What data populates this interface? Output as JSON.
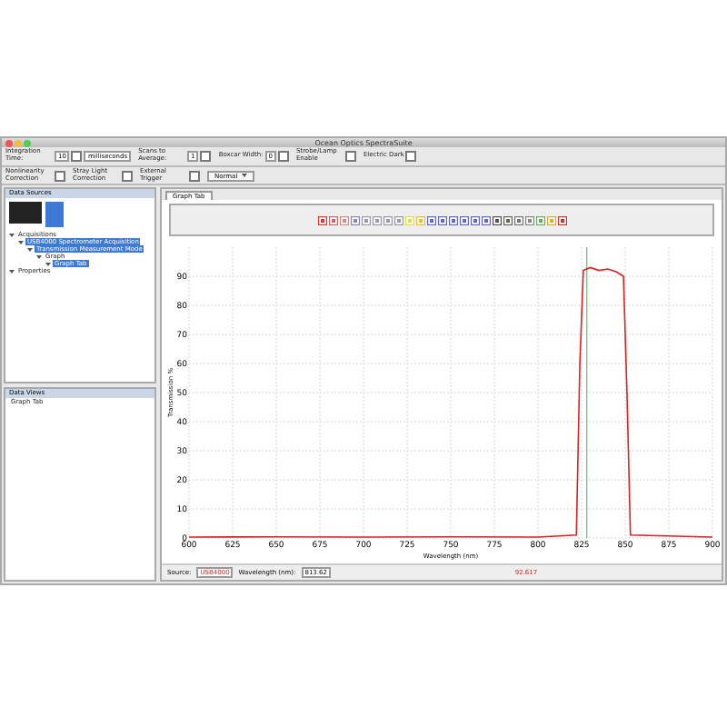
{
  "window": {
    "title": "Ocean Optics SpectraSuite"
  },
  "toolbar": {
    "controls": [
      {
        "kind": "spinner",
        "label": "Integration Time:",
        "value": "10",
        "unit": "milliseconds"
      },
      {
        "kind": "spinner",
        "label": "Scans to Average:",
        "value": "1"
      },
      {
        "kind": "spinner",
        "label": "Boxcar Width:",
        "value": "0"
      },
      {
        "kind": "check",
        "label": "Strobe/Lamp Enable",
        "checked": false
      },
      {
        "kind": "check",
        "label": "Electric Dark",
        "checked": false
      }
    ]
  },
  "toolbar_2": {
    "controls": [
      {
        "kind": "check",
        "label": "Nonlinearity Correction",
        "checked": false
      },
      {
        "kind": "check",
        "label": "Stray Light Correction",
        "checked": false
      },
      {
        "kind": "check",
        "label": "External Trigger",
        "checked": false
      },
      {
        "kind": "select",
        "value": "Normal"
      }
    ]
  },
  "data_sources": {
    "title": "Data Sources",
    "tree": [
      {
        "label": "Acquisitions",
        "selected": false,
        "children": [
          {
            "label": "USB4000 Spectrometer Acquisition",
            "selected": true,
            "children": [
              {
                "label": "Transmission Measurement Mode",
                "selected": true,
                "children": [
                  {
                    "label": "Graph",
                    "selected": false,
                    "children": [
                      {
                        "label": "Graph Tab",
                        "selected": true
                      }
                    ]
                  }
                ]
              }
            ]
          }
        ]
      },
      {
        "label": "Properties",
        "selected": false
      }
    ]
  },
  "data_views": {
    "title": "Data Views",
    "items": [
      {
        "label": "Graph Tab"
      }
    ]
  },
  "graph_tab": {
    "label": "Graph Tab",
    "selected": true,
    "chart_data": {
      "type": "line",
      "xlabel": "Wavelength (nm)",
      "ylabel": "Transmission %",
      "xlim": [
        600,
        900
      ],
      "ylim": [
        0,
        100
      ],
      "grid": true,
      "xticks": [
        600,
        625,
        650,
        675,
        700,
        725,
        750,
        775,
        800,
        825,
        850,
        875,
        900
      ],
      "yticks": [
        0,
        10,
        20,
        30,
        40,
        50,
        60,
        70,
        80,
        90
      ],
      "x": [
        600,
        650,
        700,
        750,
        800,
        822,
        824,
        826,
        830,
        835,
        840,
        845,
        849,
        851,
        853,
        900
      ],
      "series": [
        {
          "color": "#e02020",
          "values": [
            0.3,
            0.4,
            0.3,
            0.4,
            0.3,
            1,
            60,
            92,
            93,
            92,
            92.5,
            91.5,
            90,
            50,
            1,
            0.3
          ]
        }
      ],
      "ref_lines": [
        {
          "axis": "x",
          "value": 828,
          "color": "#55cc55"
        }
      ]
    }
  },
  "status": {
    "source_label": "Source:",
    "source": "USB4000",
    "wavelength_label": "Wavelength (nm):",
    "wavelength": "813.62",
    "reading": "92.617"
  }
}
